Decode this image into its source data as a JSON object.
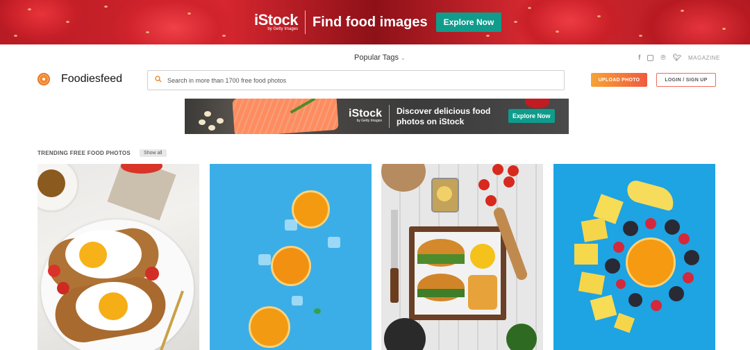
{
  "top_banner": {
    "logo_main": "iStock",
    "logo_sub": "by Getty Images",
    "headline": "Find food images",
    "cta": "Explore Now"
  },
  "nav": {
    "popular_tags": "Popular Tags",
    "magazine": "MAGAZINE",
    "social_icons": [
      "facebook-icon",
      "instagram-icon",
      "pinterest-icon",
      "twitter-icon"
    ]
  },
  "brand": {
    "name": "Foodiesfeed"
  },
  "search": {
    "placeholder": "Search in more than 1700 free food photos"
  },
  "actions": {
    "upload": "UPLOAD PHOTO",
    "login": "LOGIN / SIGN UP"
  },
  "ad": {
    "logo_main": "iStock",
    "logo_sub": "by Getty Images",
    "text": "Discover delicious food photos on iStock",
    "cta": "Explore Now"
  },
  "trending": {
    "title": "TRENDING FREE FOOD PHOTOS",
    "show_all": "Show all"
  },
  "colors": {
    "accent_orange": "#f08a30",
    "cta_teal": "#0f9c8c",
    "banner_red": "#d6262f",
    "photo_blue": "#3baee8"
  }
}
